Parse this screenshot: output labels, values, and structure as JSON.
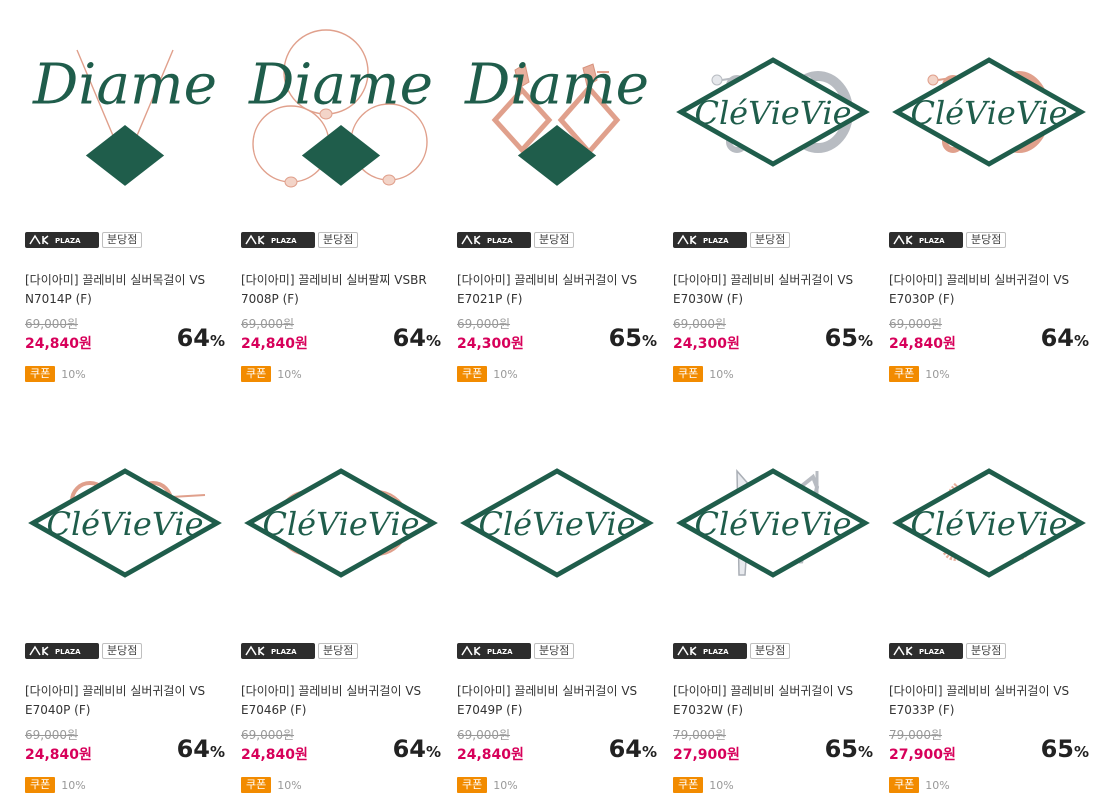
{
  "store": {
    "ak_logo_text": "PLAZA",
    "branch_label": "분당점"
  },
  "brand_logos": {
    "diame": "Diame",
    "clevievie": "CléVieVie"
  },
  "coupon": {
    "label": "쿠폰",
    "rate": "10%"
  },
  "products": [
    {
      "brand": "diame",
      "type": "necklace",
      "title": "[다이아미] 끌레비비 실버목걸이 VS N7014P (F)",
      "orig_price": "69,000원",
      "sale_price": "24,840원",
      "discount": "64",
      "pct": "%"
    },
    {
      "brand": "diame",
      "type": "bracelet",
      "title": "[다이아미] 끌레비비 실버팔찌 VSBR 7008P (F)",
      "orig_price": "69,000원",
      "sale_price": "24,840원",
      "discount": "64",
      "pct": "%"
    },
    {
      "brand": "diame",
      "type": "diamond-drop",
      "title": "[다이아미] 끌레비비 실버귀걸이 VS E7021P (F)",
      "orig_price": "69,000원",
      "sale_price": "24,300원",
      "discount": "65",
      "pct": "%"
    },
    {
      "brand": "clevievie",
      "type": "hoop-silver",
      "title": "[다이아미] 끌레비비 실버귀걸이 VS E7030W (F)",
      "orig_price": "69,000원",
      "sale_price": "24,300원",
      "discount": "65",
      "pct": "%"
    },
    {
      "brand": "clevievie",
      "type": "hoop-rose",
      "title": "[다이아미] 끌레비비 실버귀걸이 VS E7030P (F)",
      "orig_price": "69,000원",
      "sale_price": "24,840원",
      "discount": "64",
      "pct": "%"
    },
    {
      "brand": "clevievie",
      "type": "pear-stud",
      "title": "[다이아미] 끌레비비 실버귀걸이 VS E7040P (F)",
      "orig_price": "69,000원",
      "sale_price": "24,840원",
      "discount": "64",
      "pct": "%"
    },
    {
      "brand": "clevievie",
      "type": "disc-stud",
      "title": "[다이아미] 끌레비비 실버귀걸이 VS E7046P (F)",
      "orig_price": "69,000원",
      "sale_price": "24,840원",
      "discount": "64",
      "pct": "%"
    },
    {
      "brand": "clevievie",
      "type": "circle-stud",
      "title": "[다이아미] 끌레비비 실버귀걸이 VS E7049P (F)",
      "orig_price": "69,000원",
      "sale_price": "24,840원",
      "discount": "64",
      "pct": "%"
    },
    {
      "brand": "clevievie",
      "type": "spike-silver",
      "title": "[다이아미] 끌레비비 실버귀걸이 VS E7032W (F)",
      "orig_price": "79,000원",
      "sale_price": "27,900원",
      "discount": "65",
      "pct": "%"
    },
    {
      "brand": "clevievie",
      "type": "twist-rose",
      "title": "[다이아미] 끌레비비 실버귀걸이 VS E7033P (F)",
      "orig_price": "79,000원",
      "sale_price": "27,900원",
      "discount": "65",
      "pct": "%"
    }
  ],
  "colors": {
    "sale_price": "#d7005a",
    "coupon_bg": "#f28b00",
    "rose_gold": "#e0a08c",
    "silver": "#b8bcc2",
    "brand_green": "#1f5d4b"
  }
}
